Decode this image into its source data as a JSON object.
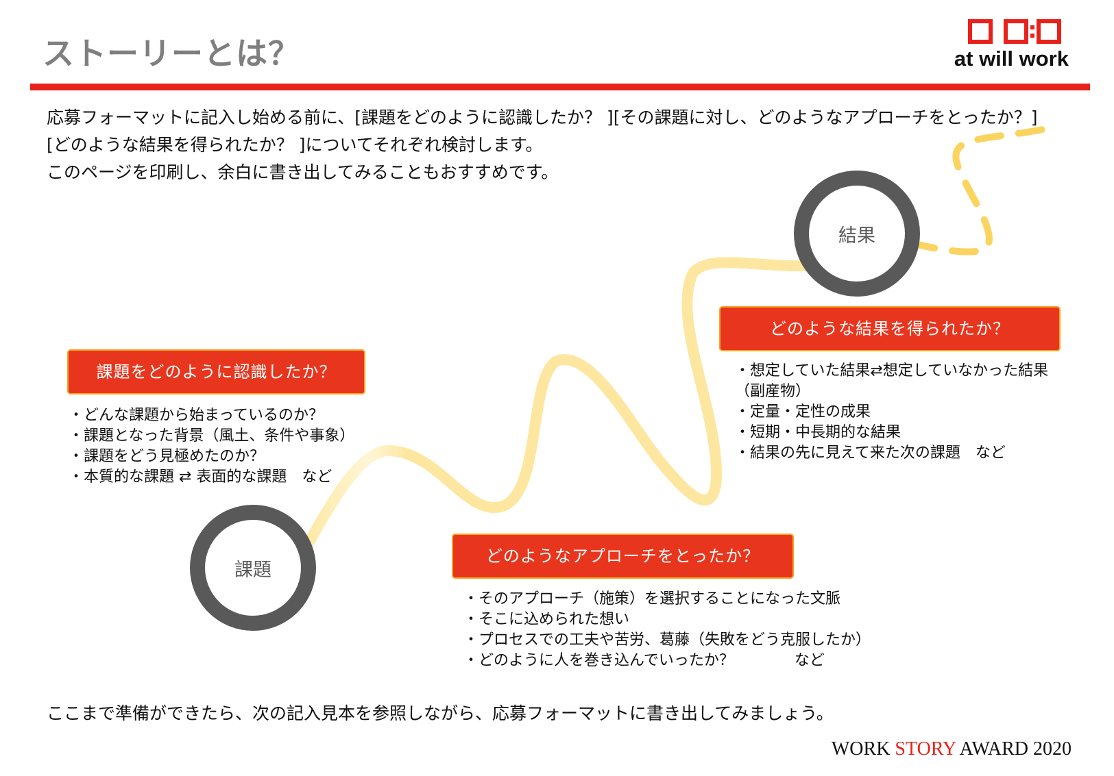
{
  "header": {
    "title": "ストーリーとは？",
    "logo_text": "at will work"
  },
  "intro": {
    "line1": "応募フォーマットに記入し始める前に、[課題をどのように認識したか？ ][その課題に対し、どのようなアプローチをとったか？][どのような結果を得られたか？ ]についてそれぞれ検討します。",
    "line2": "このページを印刷し、余白に書き出してみることもおすすめです。"
  },
  "nodes": {
    "start": "課題",
    "end": "結果"
  },
  "sections": {
    "issue": {
      "heading": "課題をどのように認識したか？",
      "items": [
        "・どんな課題から始まっているのか？",
        "・課題となった背景（風土、条件や事象）",
        "・課題をどう見極めたのか？",
        "・本質的な課題 ⇄ 表面的な課題　など"
      ]
    },
    "approach": {
      "heading": "どのようなアプローチをとったか？",
      "items": [
        "・そのアプローチ（施策）を選択することになった文脈",
        "・そこに込められた想い",
        "・プロセスでの工夫や苦労、葛藤（失敗をどう克服したか）",
        "・どのように人を巻き込んでいったか？　　　　など"
      ]
    },
    "result": {
      "heading": "どのような結果を得られたか？",
      "items": [
        "・想定していた結果⇄想定していなかった結果（副産物）",
        "・定量・定性の成果",
        "・短期・中長期的な結果",
        "・結果の先に見えて来た次の課題　など"
      ]
    }
  },
  "closing": "ここまで準備ができたら、次の記入見本を参照しながら、応募フォーマットに書き出してみましょう。",
  "footer": {
    "award_prefix": "WORK ",
    "award_accent": "STORY",
    "award_suffix": " AWARD 2020"
  },
  "colors": {
    "accent_red": "#e8221b",
    "box_red": "#e8361e",
    "box_border": "#f5a623",
    "path_yellow": "#fde7a0",
    "dash_yellow": "#fbd460",
    "ring_gray": "#595959",
    "title_gray": "#7f7f7f"
  }
}
